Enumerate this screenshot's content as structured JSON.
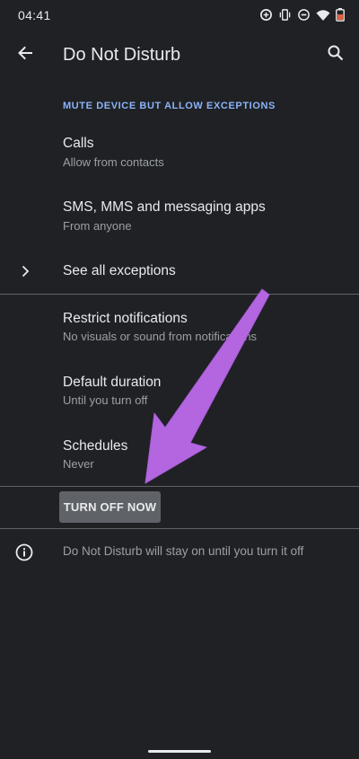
{
  "status_bar": {
    "time": "04:41",
    "icons": [
      "data-saver-icon",
      "vibrate-icon",
      "dnd-icon",
      "wifi-icon",
      "battery-icon"
    ]
  },
  "app_bar": {
    "title": "Do Not Disturb",
    "back_icon": "arrow-back-icon",
    "search_icon": "search-icon"
  },
  "section": {
    "header": "MUTE DEVICE BUT ALLOW EXCEPTIONS"
  },
  "preferences": {
    "calls": {
      "title": "Calls",
      "summary": "Allow from contacts"
    },
    "messages": {
      "title": "SMS, MMS and messaging apps",
      "summary": "From anyone"
    },
    "exceptions": {
      "title": "See all exceptions"
    },
    "restrict": {
      "title": "Restrict notifications",
      "summary": "No visuals or sound from notifications"
    },
    "duration": {
      "title": "Default duration",
      "summary": "Until you turn off"
    },
    "schedules": {
      "title": "Schedules",
      "summary": "Never"
    }
  },
  "turn_off_button": "TURN OFF NOW",
  "info_text": "Do Not Disturb will stay on until you turn it off",
  "colors": {
    "background": "#202124",
    "accent": "#8ab4f8",
    "annotation_arrow": "#b366e0",
    "button_bg": "#5f6368"
  }
}
